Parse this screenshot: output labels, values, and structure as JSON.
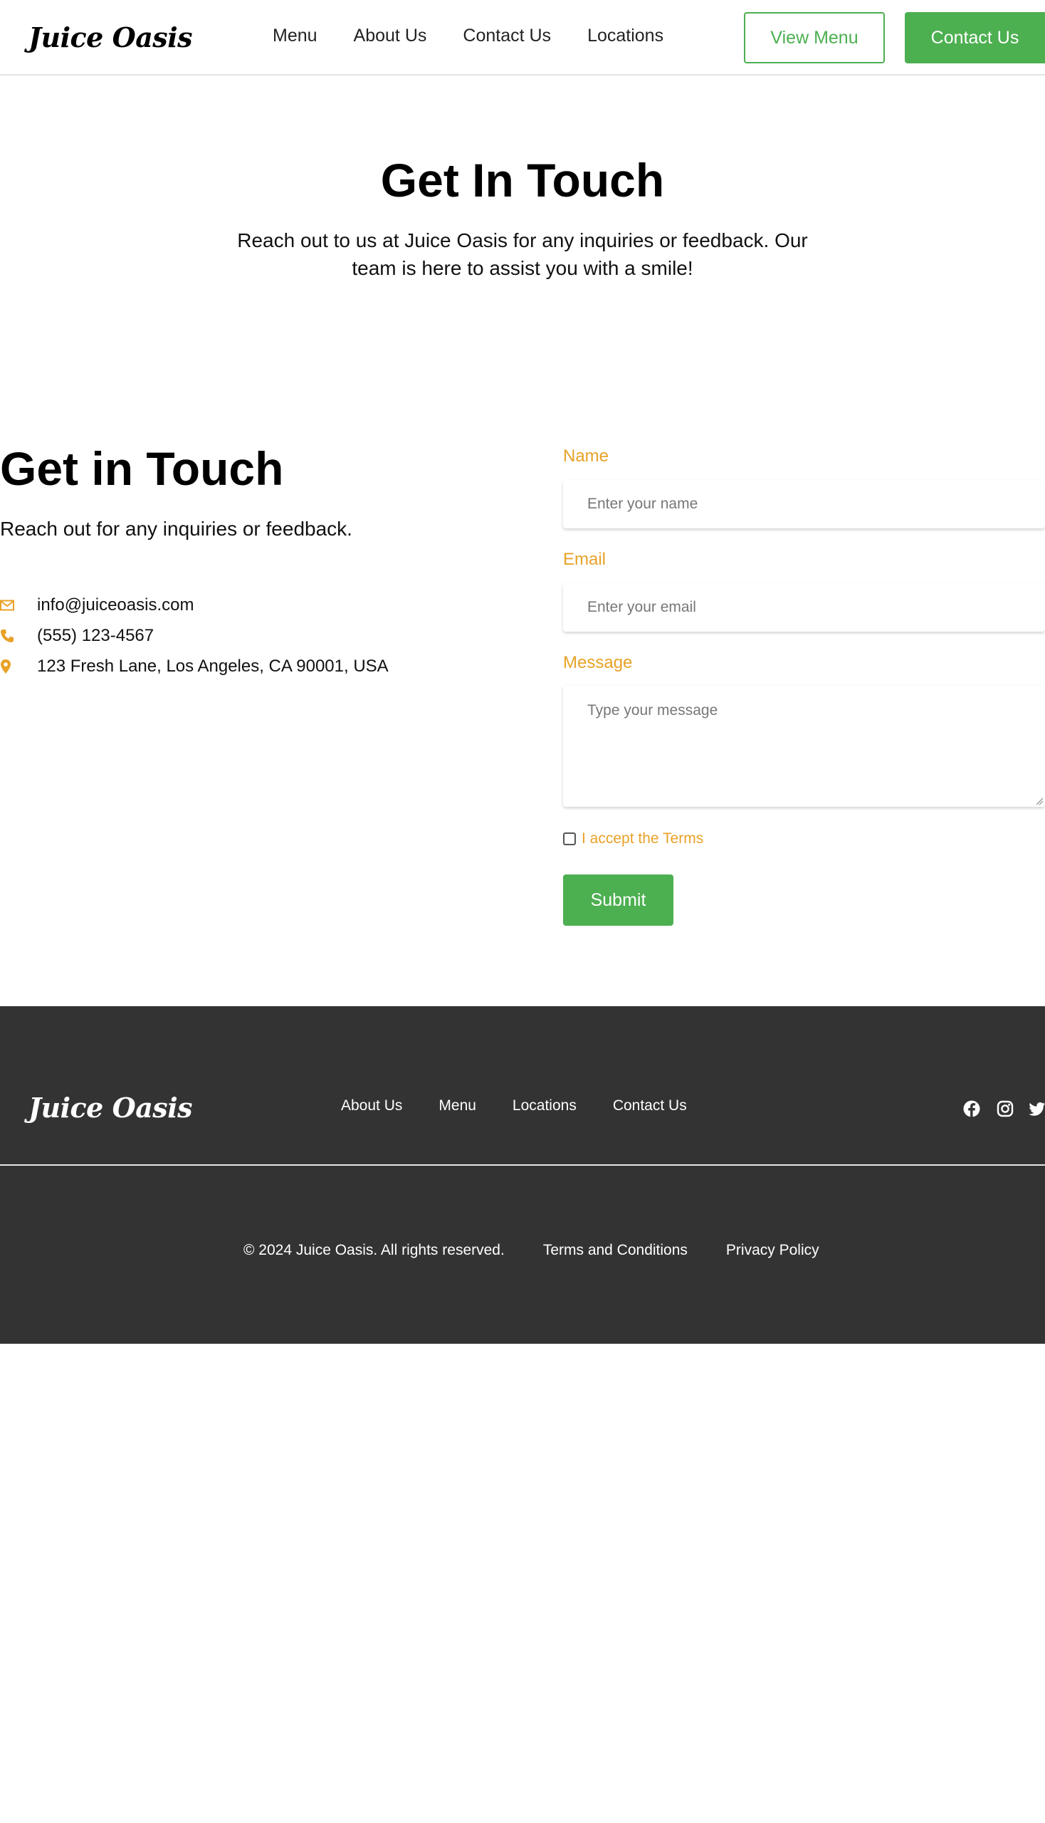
{
  "header": {
    "logo": "Juice Oasis",
    "nav": [
      "Menu",
      "About Us",
      "Contact Us",
      "Locations"
    ],
    "view_menu_label": "View Menu",
    "contact_label": "Contact Us"
  },
  "hero": {
    "title": "Get In Touch",
    "subtitle": "Reach out to us at Juice Oasis for any inquiries or feedback. Our team is here to assist you with a smile!"
  },
  "contact_info": {
    "title": "Get in Touch",
    "subtitle": "Reach out for any inquiries or feedback.",
    "email": "info@juiceoasis.com",
    "phone": "(555) 123-4567",
    "address": "123 Fresh Lane, Los Angeles, CA 90001, USA",
    "icons": [
      "envelope-icon",
      "phone-icon",
      "map-pin-icon"
    ]
  },
  "form": {
    "name_label": "Name",
    "name_placeholder": "Enter your name",
    "email_label": "Email",
    "email_placeholder": "Enter your email",
    "message_label": "Message",
    "message_placeholder": "Type your message",
    "terms_label": "I accept the Terms",
    "terms_checked": false,
    "submit_label": "Submit"
  },
  "footer": {
    "logo": "Juice Oasis",
    "nav": [
      "About Us",
      "Menu",
      "Locations",
      "Contact Us"
    ],
    "social_icons": [
      "facebook-icon",
      "instagram-icon",
      "twitter-icon"
    ],
    "copyright": "© 2024 Juice Oasis. All rights reserved.",
    "terms_link": "Terms and Conditions",
    "privacy_link": "Privacy Policy"
  },
  "colors": {
    "accent_green": "#4caf50",
    "accent_orange": "#e8a228",
    "footer_bg": "#333333"
  }
}
